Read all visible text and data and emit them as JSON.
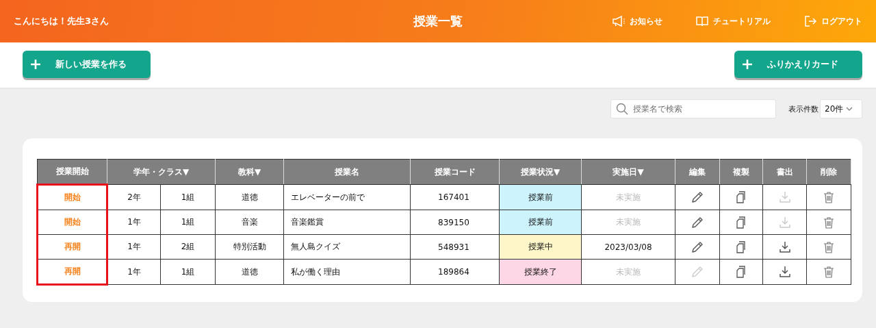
{
  "header": {
    "greeting": "こんにちは！先生3さん",
    "title": "授業一覧",
    "nav": [
      {
        "kind": "news",
        "label": "お知らせ"
      },
      {
        "kind": "tutorial",
        "label": "チュートリアル"
      },
      {
        "kind": "logout",
        "label": "ログアウト"
      }
    ]
  },
  "actions": [
    {
      "label": "新しい授業を作る"
    },
    {
      "label": "ふりかえりカード"
    }
  ],
  "search": {
    "placeholder": "授業名で検索"
  },
  "page_size": {
    "label": "表示件数",
    "value": "20件"
  },
  "table": {
    "highlight_first_column": true,
    "columns": [
      {
        "label": "授業開始",
        "kind": "single"
      },
      {
        "label": "学年・クラス▼",
        "kind": "grade_class"
      },
      {
        "label": "教科▼",
        "kind": "single"
      },
      {
        "label": "授業名",
        "kind": "single"
      },
      {
        "label": "授業コード",
        "kind": "single"
      },
      {
        "label": "授業状況▼",
        "kind": "single"
      },
      {
        "label": "実施日▼",
        "kind": "single"
      },
      {
        "label": "編集",
        "kind": "single"
      },
      {
        "label": "複製",
        "kind": "single"
      },
      {
        "label": "書出",
        "kind": "single"
      },
      {
        "label": "削除",
        "kind": "single"
      }
    ],
    "rows": [
      {
        "action": "開始",
        "grade": "2年",
        "class": "1組",
        "subject": "道徳",
        "name": "エレベーターの前で",
        "code": "167401",
        "status": "授業前",
        "color": "#cdf3fd",
        "date": "未実施",
        "date_done": false,
        "edit_disabled": false,
        "export_disabled": true
      },
      {
        "action": "開始",
        "grade": "1年",
        "class": "1組",
        "subject": "音楽",
        "name": "音楽鑑賞",
        "code": "839150",
        "status": "授業前",
        "color": "#cdf3fd",
        "date": "未実施",
        "date_done": false,
        "edit_disabled": false,
        "export_disabled": true
      },
      {
        "action": "再開",
        "grade": "1年",
        "class": "2組",
        "subject": "特別活動",
        "name": "無人島クイズ",
        "code": "548931",
        "status": "授業中",
        "color": "#fdf6c8",
        "date": "2023/03/08",
        "date_done": true,
        "edit_disabled": false,
        "export_disabled": false
      },
      {
        "action": "再開",
        "grade": "1年",
        "class": "1組",
        "subject": "道徳",
        "name": "私が働く理由",
        "code": "189864",
        "status": "授業終了",
        "color": "#fdd7e6",
        "date": "未実施",
        "date_done": false,
        "edit_disabled": true,
        "export_disabled": false
      }
    ]
  }
}
